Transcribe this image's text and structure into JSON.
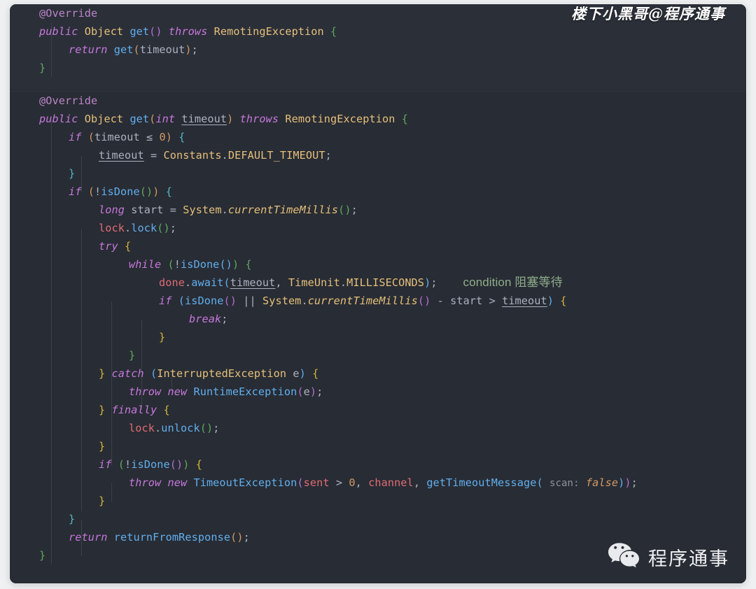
{
  "editor": {
    "theme_background": "#282c34",
    "top_block_background": "#2b2f38",
    "default_text_color": "#abb2bf",
    "annotation_color": "#8fae8c",
    "top_block": {
      "line1": {
        "annotation": "@Override"
      },
      "line2": {
        "kw_public": "public",
        "type_object": "Object",
        "method": "get",
        "paren_open": "(",
        "paren_close": ")",
        "kw_throws": "throws",
        "exception": "RemotingException",
        "brace_open": "{"
      },
      "line3": {
        "kw_return": "return",
        "method": "get",
        "paren_open": "(",
        "arg": "timeout",
        "paren_close": ")",
        "semi": ";"
      },
      "line4": {
        "brace_close": "}"
      }
    },
    "bottom_block": {
      "l01_annotation": "@Override",
      "l02": {
        "kw_public": "public",
        "type": "Object",
        "method": "get",
        "p_open": "(",
        "kw_int": "int",
        "param": "timeout",
        "p_close": ")",
        "kw_throws": "throws",
        "exception": "RemotingException",
        "brace": "{"
      },
      "l03": {
        "kw_if": "if",
        "p_open": "(",
        "var": "timeout",
        "op": "≤",
        "num": "0",
        "p_close": ")",
        "brace": "{"
      },
      "l04": {
        "var": "timeout",
        "op": "=",
        "cls": "Constants",
        "dot": ".",
        "const": "DEFAULT_TIMEOUT",
        "semi": ";"
      },
      "l05": {
        "brace": "}"
      },
      "l06": {
        "kw_if": "if",
        "p_open": "(",
        "bang": "!",
        "method": "isDone",
        "call": "()",
        "p_close": ")",
        "brace": "{"
      },
      "l07": {
        "kw_long": "long",
        "var": "start",
        "op": "=",
        "cls": "System",
        "dot": ".",
        "method": "currentTimeMillis",
        "call": "()",
        "semi": ";"
      },
      "l08": {
        "field": "lock",
        "dot": ".",
        "method": "lock",
        "call": "()",
        "semi": ";"
      },
      "l09": {
        "kw_try": "try",
        "brace": "{"
      },
      "l10": {
        "kw_while": "while",
        "p_open": "(",
        "bang": "!",
        "method": "isDone",
        "call": "()",
        "p_close": ")",
        "brace": "{"
      },
      "l11": {
        "field": "done",
        "dot": ".",
        "method": "await",
        "p_open": "(",
        "arg1": "timeout",
        "comma": ",",
        "cls": "TimeUnit",
        "dot2": ".",
        "const": "MILLISECONDS",
        "p_close": ")",
        "semi": ";",
        "note": "condition 阻塞等待"
      },
      "l12": {
        "kw_if": "if",
        "p_open": "(",
        "method": "isDone",
        "call": "()",
        "or": "||",
        "cls": "System",
        "dot": ".",
        "method2": "currentTimeMillis",
        "call2": "()",
        "minus": "-",
        "var": "start",
        "gt": ">",
        "var2": "timeout",
        "p_close": ")",
        "brace": "{"
      },
      "l13": {
        "kw_break": "break",
        "semi": ";"
      },
      "l14": {
        "brace": "}"
      },
      "l15": {
        "brace": "}"
      },
      "l16": {
        "brace_close": "}",
        "kw_catch": "catch",
        "p_open": "(",
        "exception": "InterruptedException",
        "var": "e",
        "p_close": ")",
        "brace": "{"
      },
      "l17": {
        "kw_throw": "throw",
        "kw_new": "new",
        "exception": "RuntimeException",
        "p_open": "(",
        "arg": "e",
        "p_close": ")",
        "semi": ";"
      },
      "l18": {
        "brace_close": "}",
        "kw_finally": "finally",
        "brace": "{"
      },
      "l19": {
        "field": "lock",
        "dot": ".",
        "method": "unlock",
        "call": "()",
        "semi": ";"
      },
      "l20": {
        "brace": "}"
      },
      "l21": {
        "kw_if": "if",
        "p_open": "(",
        "bang": "!",
        "method": "isDone",
        "call": "()",
        "p_close": ")",
        "brace": "{"
      },
      "l22": {
        "kw_throw": "throw",
        "kw_new": "new",
        "exception": "TimeoutException",
        "p_open": "(",
        "field1": "sent",
        "gt": ">",
        "num": "0",
        "comma1": ",",
        "field2": "channel",
        "comma2": ",",
        "method": "getTimeoutMessage",
        "p_open2": "(",
        "hint": "scan:",
        "boolean": "false",
        "p_close2": ")",
        "p_close": ")",
        "semi": ";"
      },
      "l23": {
        "brace": "}"
      },
      "l24": {
        "brace": "}"
      },
      "l25": {
        "kw_return": "return",
        "method": "returnFromResponse",
        "call": "()",
        "semi": ";"
      },
      "l26": {
        "brace": "}"
      }
    }
  },
  "watermarks": {
    "top_right": "楼下小黑哥@程序通事",
    "bottom_right_label": "程序通事",
    "bottom_right_icon": "wechat-icon"
  }
}
